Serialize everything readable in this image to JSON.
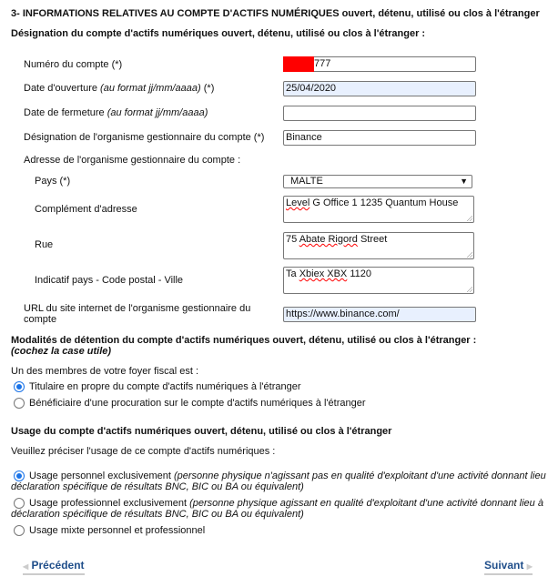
{
  "section_title": {
    "bold": "3- INFORMATIONS RELATIVES AU COMPTE D'ACTIFS NUMÉRIQUES",
    "rest": " ouvert, détenu, utilisé ou clos à l'étranger"
  },
  "designation_heading": "Désignation du compte d'actifs numériques ouvert, détenu, utilisé ou clos à l'étranger :",
  "fields": {
    "numero": {
      "label": "Numéro du compte (*)",
      "value": "777"
    },
    "ouverture": {
      "label": "Date d'ouverture ",
      "hint": "(au format jj/mm/aaaa)",
      "req": " (*)",
      "value": "25/04/2020"
    },
    "fermeture": {
      "label": "Date de fermeture ",
      "hint": "(au format jj/mm/aaaa)",
      "value": ""
    },
    "organisme": {
      "label": "Désignation de l'organisme gestionnaire du compte (*)",
      "value": "Binance"
    },
    "adresse_label": "Adresse de l'organisme gestionnaire du compte :",
    "pays": {
      "label": "Pays (*)",
      "value": "MALTE"
    },
    "complement": {
      "label": "Complément d'adresse",
      "value_a": "Level",
      "value_b": " G Office 1 1235 Quantum House"
    },
    "rue": {
      "label": "Rue",
      "value_a": "75 ",
      "value_b": "Abate Rigord",
      "value_c": " Street"
    },
    "cp": {
      "label": "Indicatif pays - Code postal - Ville",
      "value_a": "Ta ",
      "value_b": "Xbiex XBX",
      "value_c": " 1120"
    },
    "url": {
      "label": "URL du site internet de l'organisme gestionnaire du compte",
      "value": "https://www.binance.com/"
    }
  },
  "modalites": {
    "heading": "Modalités de détention du compte d'actifs numériques ouvert, détenu, utilisé ou clos à l'étranger :",
    "hint": "(cochez la case utile)",
    "question": "Un des membres de votre foyer fiscal est :",
    "options": [
      {
        "label": "Titulaire en propre du compte d'actifs numériques à l'étranger",
        "checked": true
      },
      {
        "label": "Bénéficiaire d'une procuration sur le compte d'actifs numériques à l'étranger",
        "checked": false
      }
    ]
  },
  "usage": {
    "heading": "Usage du compte d'actifs numériques ouvert, détenu, utilisé ou clos à l'étranger",
    "question": "Veuillez préciser l'usage de ce compte d'actifs numériques :",
    "options": [
      {
        "label": "Usage personnel exclusivement ",
        "detail1": "(personne physique n'agissant pas en qualité d'exploitant d'une activité donnant lieu à",
        "detail2": "déclaration spécifique de résultats BNC, BIC ou BA ou équivalent)",
        "checked": true
      },
      {
        "label": "Usage professionnel exclusivement ",
        "detail1": "(personne physique agissant en qualité d'exploitant d'une activité donnant lieu à",
        "detail2": "déclaration spécifique de résultats BNC, BIC ou BA ou équivalent)",
        "checked": false
      },
      {
        "label": "Usage mixte personnel et professionnel",
        "checked": false
      }
    ]
  },
  "nav": {
    "prev": "Précédent",
    "next": "Suivant"
  },
  "colors": {
    "redaction": "#ff0000",
    "autofill": "#e8f0fe",
    "link": "#1f4e8a",
    "radio": "#1a73e8"
  }
}
